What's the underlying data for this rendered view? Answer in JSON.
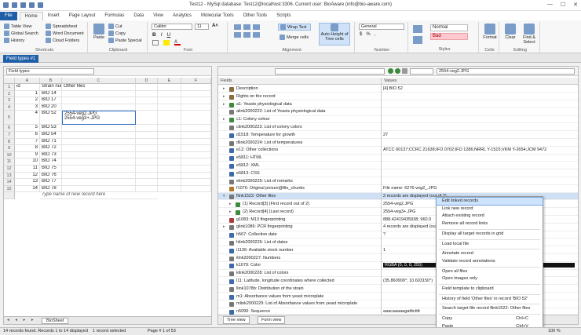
{
  "window": {
    "title": "Test12 - MySql database: Test12@localhost:3306. Current user: BioAware (info@bio-aware.com)",
    "controls": [
      "—",
      "☐",
      "✕"
    ]
  },
  "ribbon": {
    "tabs": [
      "File",
      "Home",
      "Insert",
      "Page Layout",
      "Formulas",
      "Data",
      "View",
      "Analytics",
      "Molecular Tools",
      "Other Tools",
      "Scripts"
    ],
    "active_tab": "Home",
    "shortcuts": {
      "items": [
        "Table View",
        "Global Search",
        "History",
        "Spreadsheet",
        "Word Document",
        "Cloud Folders"
      ],
      "label": "Shortcuts"
    },
    "clipboard": {
      "paste": "Paste",
      "cut": "Cut",
      "copy": "Copy",
      "paste_special": "Paste Special",
      "label": "Clipboard"
    },
    "font": {
      "family": "Calibri",
      "size": "11",
      "label": "Font"
    },
    "alignment": {
      "wrap_text": "Wrap Text",
      "merge_cells": "Merge cells",
      "auto_height": "Auto Height of Tree cells",
      "label": "Alignment"
    },
    "number": {
      "format": "General",
      "label": "Number"
    },
    "styles": {
      "normal": "Normal",
      "bad": "Bad",
      "label": "Styles"
    },
    "cells": {
      "format": "Format",
      "label": "Cells"
    },
    "editing": {
      "clear": "Clear",
      "find": "Find & Select",
      "label": "Editing"
    }
  },
  "doc_tab": "Field types #1",
  "left": {
    "field_selector": "Field types",
    "columns": [
      "A",
      "B",
      "C",
      "D",
      "E",
      "F"
    ],
    "headers": {
      "a": "id",
      "b": "Strain number",
      "c": "Other files"
    },
    "rows": [
      {
        "n": "1",
        "id": "",
        "strain": "Strain num",
        "files": "Other files",
        "header": true
      },
      {
        "n": "2",
        "id": "1",
        "strain": "BIO 14"
      },
      {
        "n": "3",
        "id": "2",
        "strain": "BIO 17"
      },
      {
        "n": "4",
        "id": "3",
        "strain": "BIO 20"
      },
      {
        "n": "5",
        "id": "4",
        "strain": "BIO 52",
        "files1": "2554-veg2.JPG",
        "files2": "2554-veg3+.JPG"
      },
      {
        "n": "6",
        "id": "5",
        "strain": "BIO 53"
      },
      {
        "n": "7",
        "id": "6",
        "strain": "BIO 54"
      },
      {
        "n": "8",
        "id": "7",
        "strain": "BIO 71"
      },
      {
        "n": "9",
        "id": "8",
        "strain": "BIO 72"
      },
      {
        "n": "10",
        "id": "9",
        "strain": "BIO 73"
      },
      {
        "n": "11",
        "id": "10",
        "strain": "BIO 74"
      },
      {
        "n": "12",
        "id": "11",
        "strain": "BIO 75"
      },
      {
        "n": "13",
        "id": "12",
        "strain": "BIO 76"
      },
      {
        "n": "14",
        "id": "13",
        "strain": "BIO 77"
      },
      {
        "n": "15",
        "id": "14",
        "strain": "BIO 78"
      }
    ],
    "new_record_placeholder": "Type name of new record here",
    "sheet_tab": "BioSheet"
  },
  "right": {
    "formula_value": "2554-veg2.JPG",
    "col_fields": "Fields",
    "col_values": "Values",
    "rows": [
      {
        "name": "Description",
        "value": "[4] BIO 52",
        "icon": "#8a6d3b",
        "depth": 0,
        "exp": "▸"
      },
      {
        "name": "Rights on the record",
        "value": "",
        "icon": "#8a6d3b",
        "depth": 0,
        "exp": "▸"
      },
      {
        "name": "a1: Yeasts physiological data",
        "value": "",
        "icon": "#3c8a3c",
        "depth": 0,
        "exp": "▸"
      },
      {
        "name": "alink2000222: List of Yeasts physiological data",
        "value": "",
        "icon": "#777",
        "depth": 0,
        "exp": ""
      },
      {
        "name": "c1: Colony colour",
        "value": "",
        "icon": "#3c8a3c",
        "depth": 0,
        "exp": "▸"
      },
      {
        "name": "clink2000223: List of colony colors",
        "value": "",
        "icon": "#777",
        "depth": 0,
        "exp": ""
      },
      {
        "name": "d1518: Temperature for growth",
        "value": "27",
        "icon": "#3c6aa8",
        "depth": 0,
        "exp": ""
      },
      {
        "name": "dlink2000224: List of temperatures",
        "value": "",
        "icon": "#777",
        "depth": 0,
        "exp": ""
      },
      {
        "name": "e12: Other collections",
        "value": "ATCC 60137;CCRC 21638;IFO 0702;IFO 1286;NRRL Y-1515;VKM Y-2654;JCM 9472",
        "icon": "#3c6aa8",
        "depth": 0,
        "exp": ""
      },
      {
        "name": "e5811: HTML",
        "value": "",
        "icon": "#3c6aa8",
        "depth": 0,
        "exp": ""
      },
      {
        "name": "e5812: XML",
        "value": "",
        "icon": "#3c6aa8",
        "depth": 0,
        "exp": ""
      },
      {
        "name": "e5813: CSS",
        "value": "",
        "icon": "#3c6aa8",
        "depth": 0,
        "exp": ""
      },
      {
        "name": "elink2000225: List of remarks",
        "value": "",
        "icon": "#777",
        "depth": 0,
        "exp": ""
      },
      {
        "name": "f1076: Original picture@file_chunks",
        "value": "File name: 6276-veg2_.JPG",
        "icon": "#b07a2a",
        "depth": 0,
        "exp": ""
      },
      {
        "name": "flink1522: Other files",
        "value": "2 records are displayed (out of 2)",
        "icon": "#777",
        "depth": 0,
        "exp": "▾",
        "sel": true
      },
      {
        "name": "(1) Record[3] (First record out of 2)",
        "value": "2554-veg2.JPG",
        "icon": "#3c8a3c",
        "depth": 1,
        "exp": "▸"
      },
      {
        "name": "(2) Record[4] (Last record)",
        "value": "2554-veg3+.JPG",
        "icon": "#3c8a3c",
        "depth": 1,
        "exp": "▸"
      },
      {
        "name": "g1083: M13 fingerprinting",
        "value": "888.42419435938; 960.0",
        "icon": "#a83c3c",
        "depth": 0,
        "exp": ""
      },
      {
        "name": "glink1086: PCR fingerprinting",
        "value": "4 records are displayed (out of 4)",
        "icon": "#777",
        "depth": 0,
        "exp": "▸"
      },
      {
        "name": "h567: Collection date",
        "value": "?",
        "icon": "#3c6aa8",
        "depth": 0,
        "exp": ""
      },
      {
        "name": "hlink2000226: List of dates",
        "value": "",
        "icon": "#777",
        "depth": 0,
        "exp": ""
      },
      {
        "name": "i1136: Available stock number",
        "value": "1",
        "icon": "#3c6aa8",
        "depth": 0,
        "exp": ""
      },
      {
        "name": "ilink2000227: Numbers",
        "value": "",
        "icon": "#777",
        "depth": 0,
        "exp": ""
      },
      {
        "name": "k1079: Color",
        "value": "RGBA (0, 0, 0, 255)",
        "icon": "#3c6aa8",
        "depth": 0,
        "exp": "",
        "dark": true
      },
      {
        "name": "klink2000228: List of colors",
        "value": "",
        "icon": "#777",
        "depth": 0,
        "exp": ""
      },
      {
        "name": "l11: Latitude, longitude coordinates where collected",
        "value": "(35.860900°; 10.603150°)",
        "icon": "#3c6aa8",
        "depth": 0,
        "exp": ""
      },
      {
        "name": "llink1078b: Distribution of the strain",
        "value": "",
        "icon": "#777",
        "depth": 0,
        "exp": ""
      },
      {
        "name": "m1: Absorbance values from yeast microplate",
        "value": "",
        "icon": "#3c6aa8",
        "depth": 0,
        "exp": ""
      },
      {
        "name": "mlink2000229: List of Absorbance values from yeast microplate",
        "value": "",
        "icon": "#777",
        "depth": 0,
        "exp": ""
      },
      {
        "name": "n5096: Sequence",
        "value": "aaacaaaaagatttctttt",
        "icon": "#3c6aa8",
        "depth": 0,
        "exp": ""
      }
    ],
    "view_tabs": [
      "Tree view",
      "Form view"
    ]
  },
  "context_menu": {
    "items": [
      {
        "label": "Edit linked records",
        "hl": true
      },
      {
        "label": "Link new record"
      },
      {
        "label": "Attach existing record"
      },
      {
        "label": "Remove all record links"
      },
      {
        "sep": true
      },
      {
        "label": "Display all target records in grid"
      },
      {
        "sep": true
      },
      {
        "label": "Load local file"
      },
      {
        "sep": true
      },
      {
        "label": "Annotate record"
      },
      {
        "label": "Validate record annotations"
      },
      {
        "sep": true
      },
      {
        "label": "Open all files"
      },
      {
        "label": "Open images only"
      },
      {
        "sep": true
      },
      {
        "label": "Field template to clipboard"
      },
      {
        "sep": true
      },
      {
        "label": "History of field 'Other files' in record 'BIO 52'"
      },
      {
        "sep": true
      },
      {
        "label": "Search target file record flink1522: Other files"
      },
      {
        "sep": true
      },
      {
        "label": "Copy",
        "shortcut": "Ctrl+C"
      },
      {
        "label": "Paste",
        "shortcut": "Ctrl+V"
      }
    ]
  },
  "status": {
    "records": "14 records found. Records 1 to 14 displayed",
    "selected": "1 record selected",
    "page": "Page # 1 of 53",
    "zoom": "100 %"
  }
}
